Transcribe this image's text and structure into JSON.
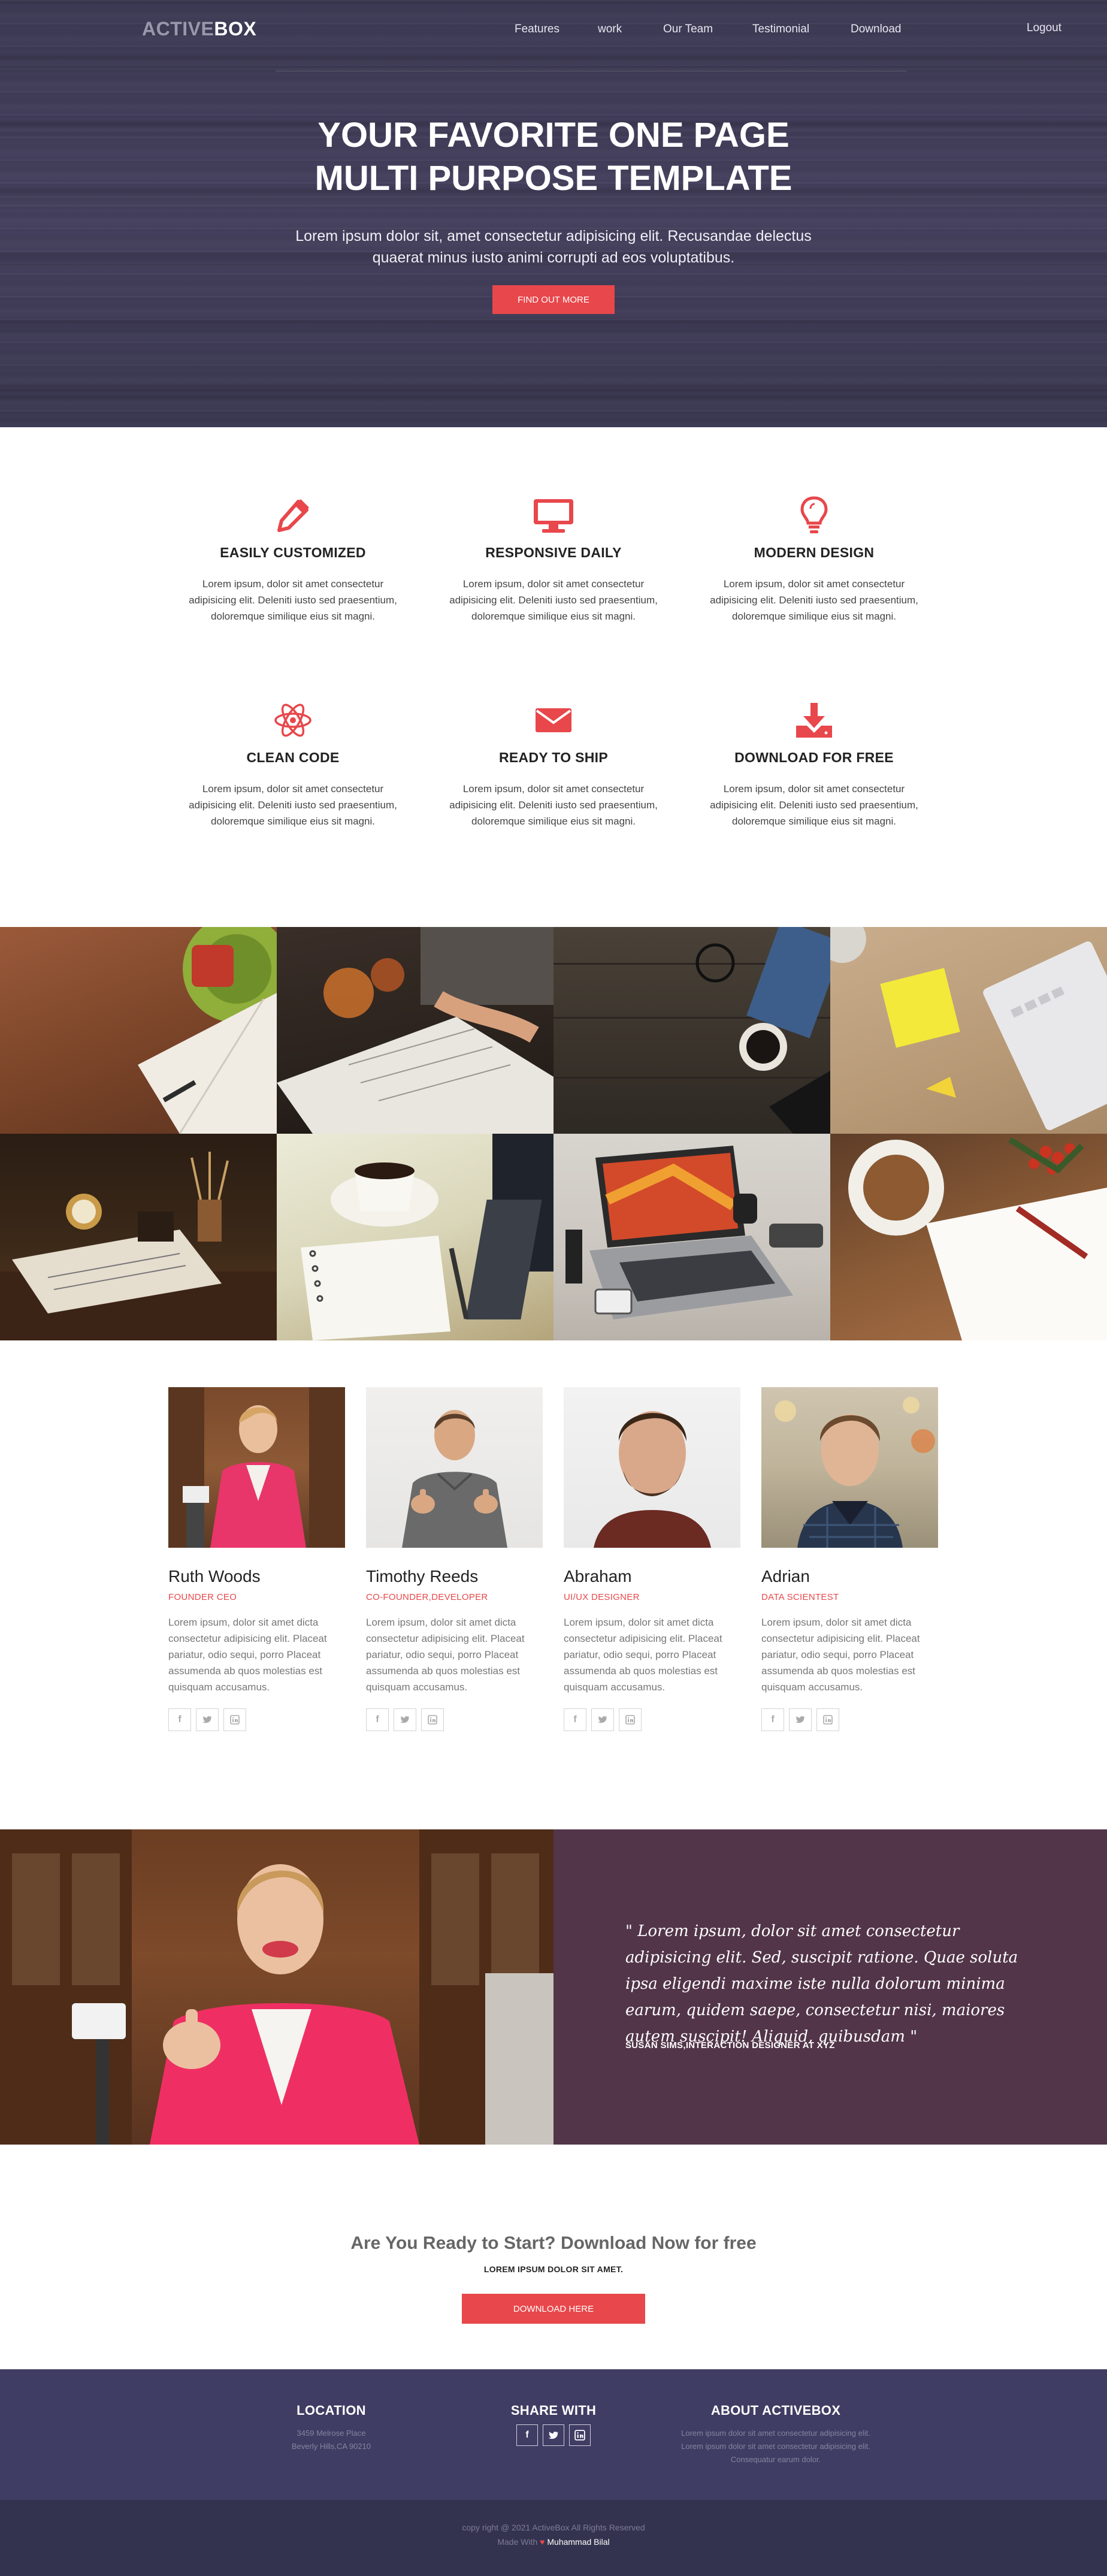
{
  "brand": {
    "part1": "ACTIVE",
    "part2": "BOX"
  },
  "nav": {
    "items": [
      {
        "label": "Features"
      },
      {
        "label": "work"
      },
      {
        "label": "Our Team"
      },
      {
        "label": "Testimonial"
      },
      {
        "label": "Download"
      }
    ],
    "logout": "Logout"
  },
  "hero": {
    "title_line1": "YOUR FAVORITE ONE PAGE",
    "title_line2": "MULTI PURPOSE TEMPLATE",
    "subtitle": "Lorem ipsum dolor sit, amet consectetur adipisicing elit. Recusandae delectus quaerat minus iusto animi corrupti ad eos voluptatibus.",
    "button": "FIND OUT MORE"
  },
  "features": [
    {
      "icon": "pencil-icon",
      "title": "EASILY CUSTOMIZED",
      "desc": "Lorem ipsum, dolor sit amet consectetur adipisicing elit. Deleniti iusto sed praesentium, doloremque similique eius sit magni."
    },
    {
      "icon": "monitor-icon",
      "title": "RESPONSIVE DAILY",
      "desc": "Lorem ipsum, dolor sit amet consectetur adipisicing elit. Deleniti iusto sed praesentium, doloremque similique eius sit magni."
    },
    {
      "icon": "lightbulb-icon",
      "title": "MODERN DESIGN",
      "desc": "Lorem ipsum, dolor sit amet consectetur adipisicing elit. Deleniti iusto sed praesentium, doloremque similique eius sit magni."
    },
    {
      "icon": "atom-icon",
      "title": "CLEAN CODE",
      "desc": "Lorem ipsum, dolor sit amet consectetur adipisicing elit. Deleniti iusto sed praesentium, doloremque similique eius sit magni."
    },
    {
      "icon": "envelope-icon",
      "title": "READY TO SHIP",
      "desc": "Lorem ipsum, dolor sit amet consectetur adipisicing elit. Deleniti iusto sed praesentium, doloremque similique eius sit magni."
    },
    {
      "icon": "download-icon",
      "title": "DOWNLOAD FOR FREE",
      "desc": "Lorem ipsum, dolor sit amet consectetur adipisicing elit. Deleniti iusto sed praesentium, doloremque similique eius sit magni."
    }
  ],
  "team": [
    {
      "name": "Ruth Woods",
      "role": "FOUNDER CEO",
      "desc": "Lorem ipsum, dolor sit amet dicta consectetur adipisicing elit. Placeat pariatur, odio sequi, porro Placeat assumenda ab quos molestias est quisquam accusamus."
    },
    {
      "name": "Timothy Reeds",
      "role": "CO-FOUNDER,DEVELOPER",
      "desc": "Lorem ipsum, dolor sit amet dicta consectetur adipisicing elit. Placeat pariatur, odio sequi, porro Placeat assumenda ab quos molestias est quisquam accusamus."
    },
    {
      "name": "Abraham",
      "role": "UI/UX DESIGNER",
      "desc": "Lorem ipsum, dolor sit amet dicta consectetur adipisicing elit. Placeat pariatur, odio sequi, porro Placeat assumenda ab quos molestias est quisquam accusamus."
    },
    {
      "name": "Adrian",
      "role": "DATA SCIENTEST",
      "desc": "Lorem ipsum, dolor sit amet dicta consectetur adipisicing elit. Placeat pariatur, odio sequi, porro Placeat assumenda ab quos molestias est quisquam accusamus."
    }
  ],
  "social_icons": [
    "facebook-icon",
    "twitter-icon",
    "linkedin-icon"
  ],
  "testimonial": {
    "quote": "\" Lorem ipsum, dolor sit amet consectetur adipisicing elit. Sed, suscipit ratione. Quae soluta ipsa eligendi maxime iste nulla dolorum minima earum, quidem saepe, consectetur nisi, maiores autem suscipit! Aliquid, quibusdam \"",
    "author": "SUSAN SIMS,INTERACTION DESIGNER AT XYZ"
  },
  "cta": {
    "title": "Are You Ready to Start? Download Now for free",
    "subtitle": "LOREM IPSUM DOLOR SIT AMET.",
    "button": "DOWNLOAD HERE"
  },
  "footer": {
    "location": {
      "title": "LOCATION",
      "line1": "3459 Melrose Place",
      "line2": "Beverly Hills,CA 90210"
    },
    "share": {
      "title": "SHARE WITH"
    },
    "about": {
      "title": "ABOUT ACTIVEBOX",
      "line1": "Lorem ipsum dolor sit amet consectetur adipisicing elit.",
      "line2": "Lorem ipsum dolor sit amet consectetur adipisicing elit.",
      "line3": "Consequatur earum dolor."
    },
    "copyright": "copy right @ 2021 ActiveBox All Rights Reserved",
    "made_with": "Made With",
    "heart": "♥",
    "author": "Muhammad Bilal"
  },
  "colors": {
    "accent": "#e8474b",
    "hero_bg": "#413d5a",
    "testimonial_bg": "#523549",
    "footer_bg": "#3f3d63",
    "bottom_bar_bg": "#34334f"
  }
}
